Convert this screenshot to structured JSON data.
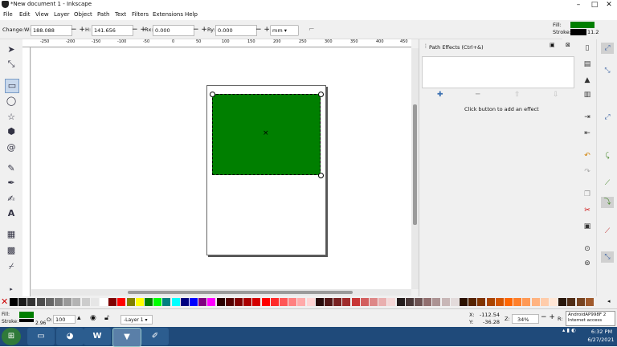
{
  "window": {
    "title": "*New document 1 - Inkscape"
  },
  "menu": [
    "File",
    "Edit",
    "View",
    "Layer",
    "Object",
    "Path",
    "Text",
    "Filters",
    "Extensions",
    "Help"
  ],
  "toolctrl": {
    "change_label": "Change:",
    "w_label": "W:",
    "w_value": "188.088",
    "h_label": "H:",
    "h_value": "141.656",
    "rx_label": "Rx:",
    "rx_value": "0.000",
    "ry_label": "Ry:",
    "ry_value": "0.000",
    "unit": "mm"
  },
  "style_indicator": {
    "fill_label": "Fill:",
    "stroke_label": "Stroke:",
    "stroke_width": "11.2",
    "fill_color": "#007f00",
    "stroke_color": "#000000"
  },
  "ruler_labels": [
    "-250",
    "-200",
    "-150",
    "-100",
    "-50",
    "0",
    "50",
    "100",
    "150",
    "200",
    "250",
    "300",
    "350",
    "400",
    "450"
  ],
  "lpe": {
    "title": "Path Effects (Ctrl+&)",
    "hint": "Click button to add an effect"
  },
  "palette_colors": [
    "#000000",
    "#1a1a1a",
    "#333333",
    "#4d4d4d",
    "#666666",
    "#808080",
    "#999999",
    "#b3b3b3",
    "#cccccc",
    "#e6e6e6",
    "#ffffff",
    "#800000",
    "#ff0000",
    "#808000",
    "#ffff00",
    "#008000",
    "#00ff00",
    "#008080",
    "#00ffff",
    "#000080",
    "#0000ff",
    "#800080",
    "#ff00ff",
    "#2b0000",
    "#550000",
    "#800000",
    "#aa0000",
    "#d40000",
    "#ff0000",
    "#ff2a2a",
    "#ff5555",
    "#ff8080",
    "#ffaaaa",
    "#ffd5d5",
    "#280b0b",
    "#501616",
    "#782121",
    "#a02c2c",
    "#c83737",
    "#d35f5f",
    "#de8787",
    "#e9afaf",
    "#f4d7d7",
    "#241c1c",
    "#483737",
    "#6c5353",
    "#916f6f",
    "#ac9393",
    "#c8b7b7",
    "#e3dbdb",
    "#2b1100",
    "#552200",
    "#803300",
    "#aa4400",
    "#d45500",
    "#ff6600",
    "#ff7f2a",
    "#ff9955",
    "#ffb380",
    "#ffccaa",
    "#ffe6d5",
    "#28170b",
    "#502d16",
    "#784421",
    "#a05a2c"
  ],
  "status": {
    "fill_label": "Fill:",
    "stroke_label": "Stroke:",
    "stroke_width": "2.96",
    "opacity_label": "O:",
    "opacity_value": "100",
    "layer": "-Layer 1",
    "x_label": "X:",
    "x_value": "-112.54",
    "y_label": "Y:",
    "y_value": "-36.28",
    "z_label": "Z:",
    "zoom": "34%",
    "r_label": "R:",
    "network_line1": "AndroidAP998F 2",
    "network_line2": "Internet access"
  },
  "taskbar": {
    "time": "6:32 PM",
    "date": "6/27/2021"
  }
}
